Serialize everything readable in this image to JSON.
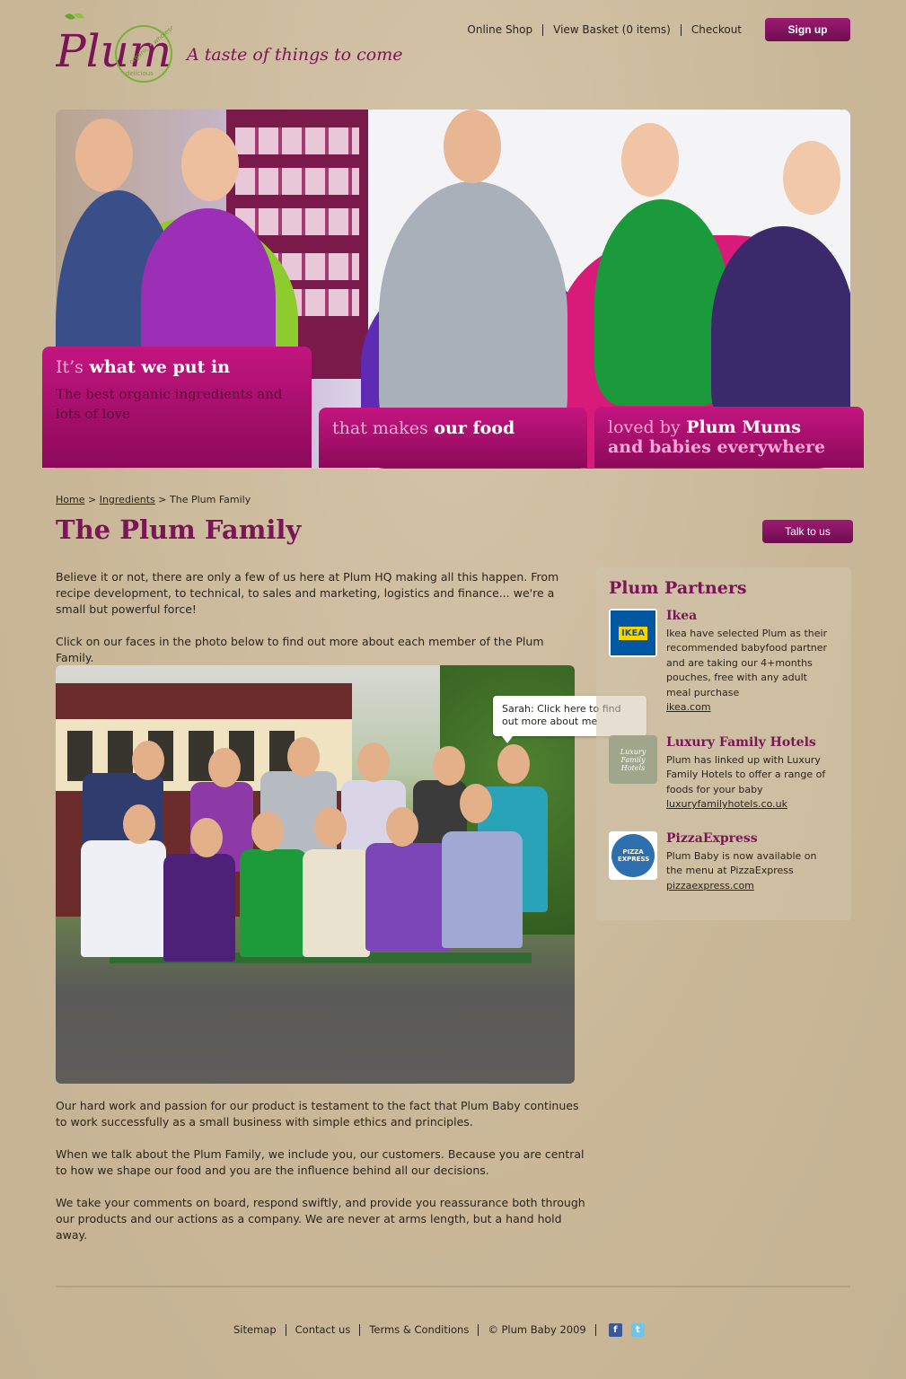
{
  "header": {
    "tagline": "A taste of things to come",
    "logo_text": "Plum",
    "logo_ring_text": "organic • wholesome • delicious",
    "nav": [
      "Online Shop",
      "View Basket (0 items)",
      "Checkout"
    ],
    "signup_label": "Sign up"
  },
  "hero": {
    "box1_pale": "It’s",
    "box1_bold": " what we put in",
    "box1_sub": "The best organic ingredients and lots of love",
    "box2_pale": "that makes",
    "box2_bold": " our food",
    "box3_pale": "loved by",
    "box3_bold": " Plum Mums",
    "box3_line2": "and babies everywhere"
  },
  "breadcrumb": {
    "home": "Home",
    "sep1": " > ",
    "ingredients": "Ingredients",
    "sep2": " > ",
    "current": "The Plum Family"
  },
  "page": {
    "title": "The Plum Family",
    "talk_label": "Talk to us",
    "intro1": "Believe it or not, there are only a few of us here at Plum HQ making all this happen. From recipe development, to technical, to sales and marketing, logistics and finance... we're a small but powerful force!",
    "intro2": "Click on our faces in the photo below to find out more about each member of the Plum Family.",
    "tooltip": "Sarah: Click here to find out more about me",
    "body1": "Our hard work and passion for our product is testament to the fact that Plum Baby continues to work successfully as a small business with simple ethics and principles.",
    "body2": "When we talk about the Plum Family, we include you, our customers. Because you are central to how we shape our food and you are the influence behind all our decisions.",
    "body3": "We take your comments on board, respond swiftly, and provide you reassurance both through our products and our actions as a company. We are never at arms length, but a hand hold away."
  },
  "partners": {
    "heading": "Plum Partners",
    "items": [
      {
        "name": "Ikea",
        "logo_text": "IKEA",
        "desc": "Ikea have selected Plum as their recommended babyfood partner and are taking our 4+months pouches, free with any adult meal purchase",
        "link": "ikea.com"
      },
      {
        "name": "Luxury Family Hotels",
        "logo_text": "Luxury Family Hotels",
        "desc": "Plum has linked up with Luxury Family Hotels to offer a range of foods for your baby",
        "link": "luxuryfamilyhotels.co.uk"
      },
      {
        "name": "PizzaExpress",
        "logo_text": "PIZZA EXPRESS",
        "desc": "Plum Baby is now available on the menu at PizzaExpress",
        "link": "pizzaexpress.com"
      }
    ]
  },
  "footer": {
    "sitemap": "Sitemap",
    "contact": "Contact us",
    "terms": "Terms & Conditions",
    "copyright": "© Plum Baby 2009"
  },
  "colors": {
    "brand": "#7a1656",
    "hero_box": "#c3157f",
    "background": "#cbb99c"
  }
}
